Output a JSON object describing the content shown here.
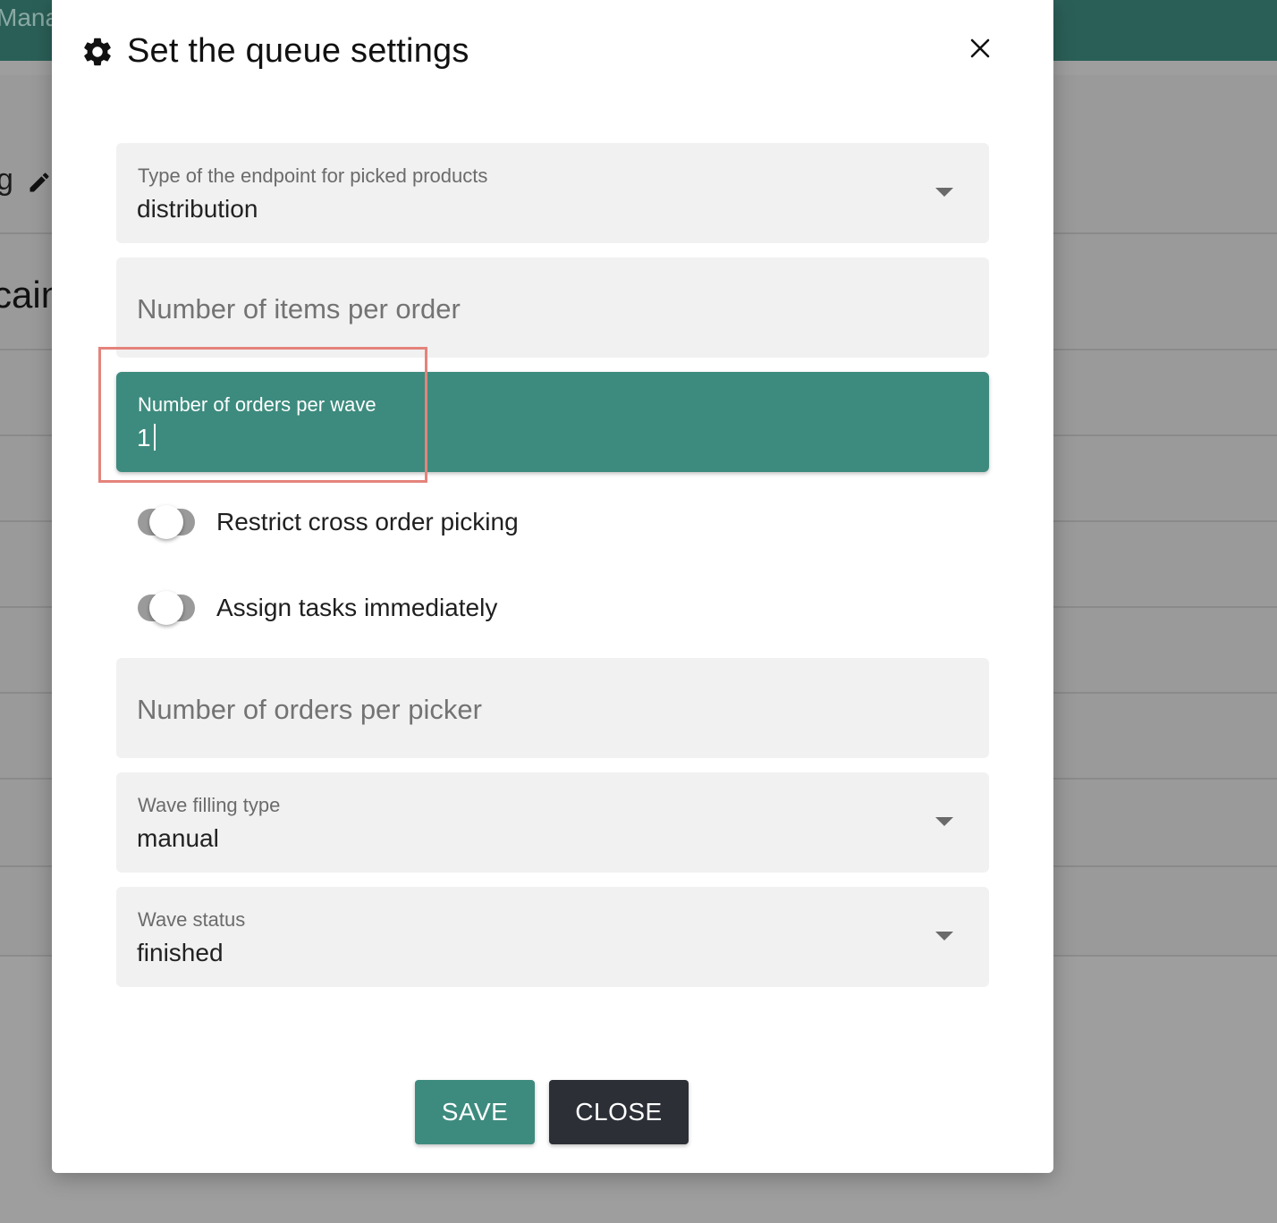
{
  "background": {
    "brand_fragment": "Manag",
    "heading_fragment": "g",
    "title_fragment": "cain"
  },
  "dialog": {
    "title": "Set the queue settings",
    "icons": {
      "header": "gear-icon",
      "close": "close-icon",
      "edit": "pencil-icon"
    },
    "fields": {
      "endpoint_type": {
        "label": "Type of the endpoint for picked products",
        "value": "distribution"
      },
      "items_per_order": {
        "placeholder": "Number of items per order"
      },
      "orders_per_wave": {
        "label": "Number of orders per wave",
        "value": "1"
      },
      "orders_per_picker": {
        "placeholder": "Number of orders per picker"
      },
      "wave_filling_type": {
        "label": "Wave filling type",
        "value": "manual"
      },
      "wave_status": {
        "label": "Wave status",
        "value": "finished"
      }
    },
    "toggles": {
      "restrict_cross_order": {
        "label": "Restrict cross order picking",
        "checked": false
      },
      "assign_immediately": {
        "label": "Assign tasks immediately",
        "checked": false
      }
    },
    "buttons": {
      "save": "SAVE",
      "close": "CLOSE"
    }
  },
  "colors": {
    "accent": "#3d8b7e",
    "topbar": "#2a5f57",
    "close_button": "#2c2f36",
    "highlight": "#e4837b"
  }
}
